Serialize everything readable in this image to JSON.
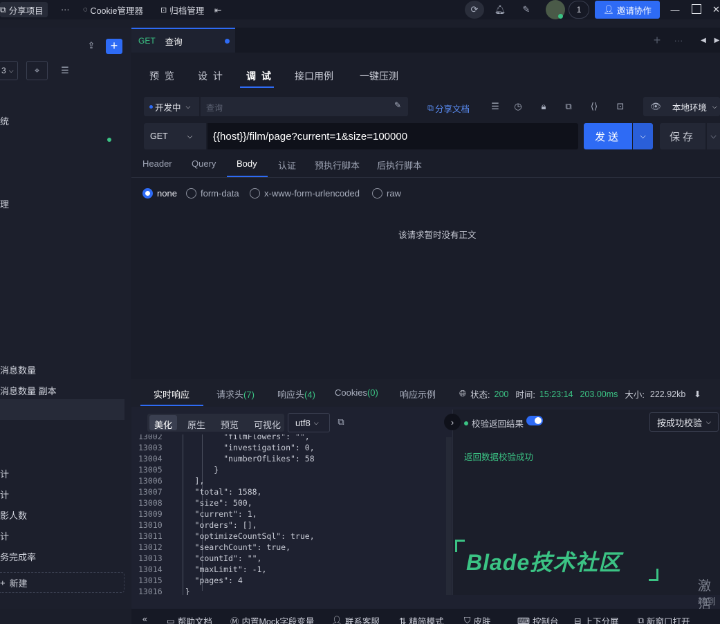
{
  "topbar": {
    "share_project": "分享项目",
    "more": "···",
    "cookie_manager": "Cookie管理器",
    "archive_manager": "归档管理",
    "notification_count": "1",
    "invite_label": "邀请协作"
  },
  "sidebar": {
    "items": [
      {
        "label": "统"
      },
      {
        "label": "理"
      },
      {
        "label": "消息数量"
      },
      {
        "label": "消息数量 副本"
      },
      {
        "label": "计"
      },
      {
        "label": "计"
      },
      {
        "label": "影人数"
      },
      {
        "label": "计"
      },
      {
        "label": "务完成率"
      }
    ],
    "new_label": "新建",
    "env_partial": "3"
  },
  "tab": {
    "method": "GET",
    "name": "查询"
  },
  "subtabs": [
    "预 览",
    "设 计",
    "调 试",
    "接口用例",
    "一键压测"
  ],
  "env": {
    "status": "开发中",
    "search_placeholder": "查询",
    "share_doc": "分享文档",
    "local_env": "本地环境"
  },
  "request": {
    "method": "GET",
    "url": "{{host}}/film/page?current=1&size=100000",
    "send": "发送",
    "save": "保存"
  },
  "req_tabs": [
    "Header",
    "Query",
    "Body",
    "认证",
    "预执行脚本",
    "后执行脚本"
  ],
  "body_types": [
    "none",
    "form-data",
    "x-www-form-urlencoded",
    "raw"
  ],
  "empty_body": "该请求暂时没有正文",
  "response": {
    "tabs": [
      {
        "label": "实时响应",
        "count": ""
      },
      {
        "label": "请求头",
        "count": "(7)"
      },
      {
        "label": "响应头",
        "count": "(4)"
      },
      {
        "label": "Cookies",
        "count": "(0)"
      },
      {
        "label": "响应示例",
        "count": ""
      }
    ],
    "status_label": "状态:",
    "status_value": "200",
    "time_label": "时间:",
    "time_value": "15:23:14",
    "duration": "203.00ms",
    "size_label": "大小:",
    "size_value": "222.92kb",
    "formats": [
      "美化",
      "原生",
      "预览",
      "可视化"
    ],
    "encoding": "utf8",
    "code_lines": [
      {
        "ln": "13002",
        "text": "            \"filmFlowers\": \"\","
      },
      {
        "ln": "13003",
        "text": "            \"investigation\": 0,"
      },
      {
        "ln": "13004",
        "text": "            \"numberOfLikes\": 58"
      },
      {
        "ln": "13005",
        "text": "          }"
      },
      {
        "ln": "13006",
        "text": "      ],"
      },
      {
        "ln": "13007",
        "text": "      \"total\": 1588,"
      },
      {
        "ln": "13008",
        "text": "      \"size\": 500,"
      },
      {
        "ln": "13009",
        "text": "      \"current\": 1,"
      },
      {
        "ln": "13010",
        "text": "      \"orders\": [],"
      },
      {
        "ln": "13011",
        "text": "      \"optimizeCountSql\": true,"
      },
      {
        "ln": "13012",
        "text": "      \"searchCount\": true,"
      },
      {
        "ln": "13013",
        "text": "      \"countId\": \"\","
      },
      {
        "ln": "13014",
        "text": "      \"maxLimit\": -1,"
      },
      {
        "ln": "13015",
        "text": "      \"pages\": 4"
      },
      {
        "ln": "13016",
        "text": "    }"
      }
    ],
    "validate_label": "校验返回结果",
    "validate_mode": "按成功校验",
    "validate_result": "返回数据校验成功"
  },
  "watermark": "Blade技术社区",
  "activation": {
    "line1": "激活",
    "line2": "转到"
  },
  "bottombar": [
    "帮助文档",
    "内置Mock字段变量",
    "联系客服",
    "精简模式",
    "皮肤",
    "控制台",
    "上下分屏",
    "新窗口打开"
  ],
  "colors": {
    "accent": "#2e6bf5",
    "get_method": "#3bc384",
    "success": "#3bc384"
  }
}
